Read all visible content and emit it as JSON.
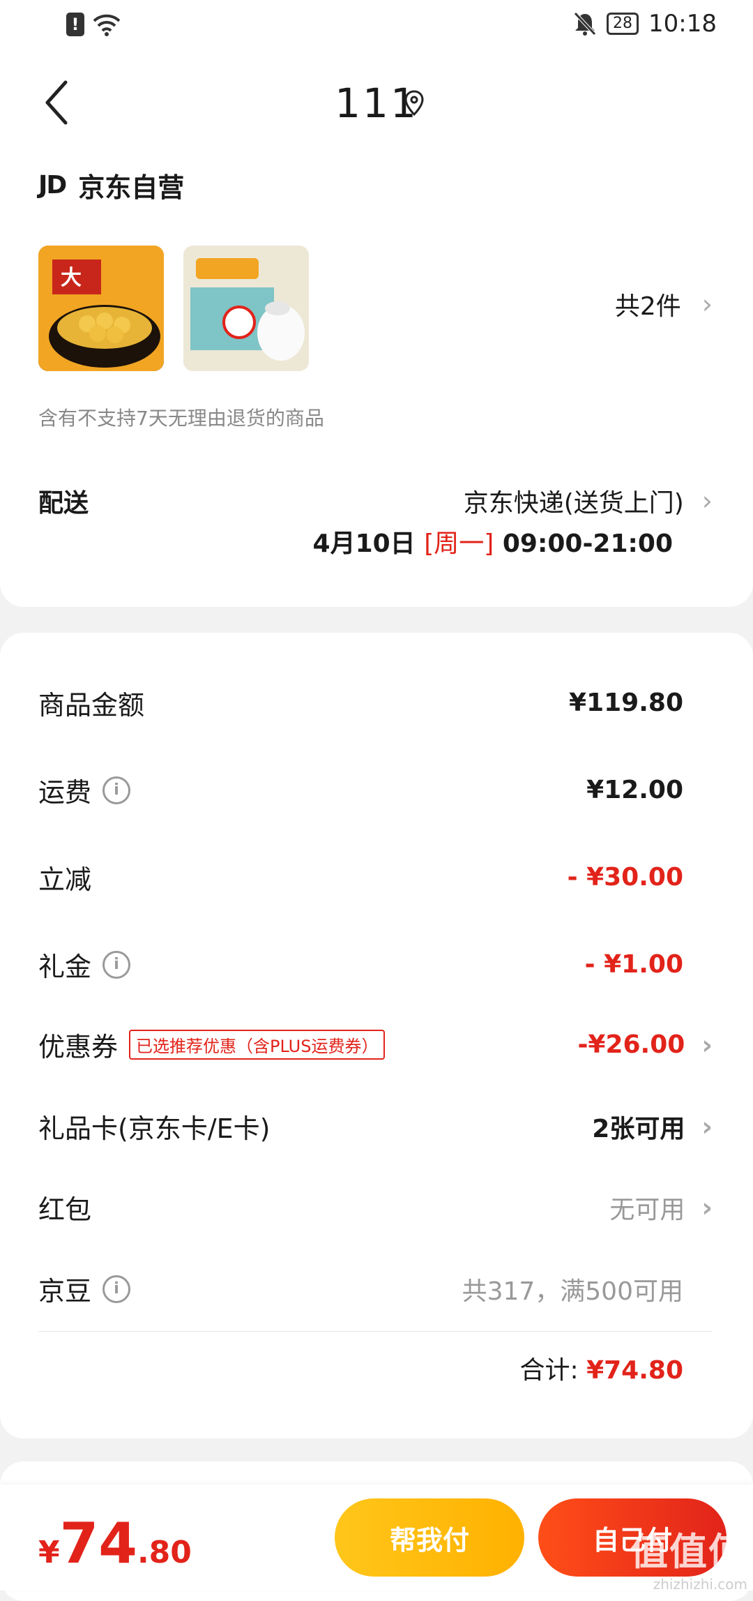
{
  "status_bar": {
    "time": "10:18",
    "battery": "28"
  },
  "nav": {
    "title": "111"
  },
  "shop": {
    "logo": "JD",
    "name": "京东自营"
  },
  "products": {
    "count_label": "共2件"
  },
  "notice": "含有不支持7天无理由退货的商品",
  "delivery": {
    "label": "配送",
    "method": "京东快递(送货上门)",
    "date": "4月10日",
    "weekday": "[周一]",
    "time": "09:00-21:00"
  },
  "summary": {
    "goods": {
      "label": "商品金额",
      "value": "¥119.80"
    },
    "shipping": {
      "label": "运费",
      "value": "¥12.00"
    },
    "discount": {
      "label": "立减",
      "value": "- ¥30.00"
    },
    "gift_money": {
      "label": "礼金",
      "value": "- ¥1.00"
    },
    "coupon": {
      "label": "优惠券",
      "tag": "已选推荐优惠（含PLUS运费券）",
      "value": "-¥26.00"
    },
    "gift_card": {
      "label": "礼品卡(京东卡/E卡)",
      "value": "2张可用"
    },
    "red_packet": {
      "label": "红包",
      "value": "无可用"
    },
    "jingdou": {
      "label": "京豆",
      "value": "共317，满500可用"
    },
    "total_label": "合计:",
    "total_value": "¥74.80"
  },
  "bottom": {
    "currency": "¥",
    "price_int": "74",
    "price_dec": ".80",
    "help_pay": "帮我付",
    "self_pay": "自己付"
  },
  "watermark": {
    "main": "值值值",
    "sub": "zhizhizhi.com"
  },
  "colors": {
    "accent_red": "#e2231a",
    "help_yellow": "#ffb100"
  }
}
